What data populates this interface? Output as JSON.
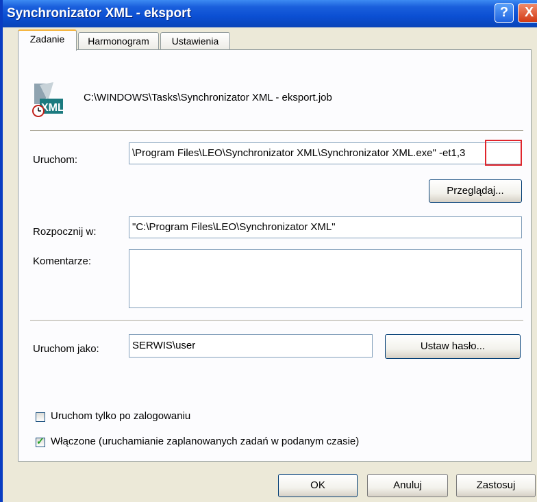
{
  "window": {
    "title": "Synchronizator XML - eksport",
    "help_label": "?",
    "close_label": "X"
  },
  "tabs": [
    {
      "label": "Zadanie",
      "active": true
    },
    {
      "label": "Harmonogram",
      "active": false
    },
    {
      "label": "Ustawienia",
      "active": false
    }
  ],
  "task": {
    "file_path": "C:\\WINDOWS\\Tasks\\Synchronizator XML - eksport.job",
    "icon": "xml-task-icon",
    "run_label": "Uruchom:",
    "run_value": "\\Program Files\\LEO\\Synchronizator XML\\Synchronizator XML.exe\" -et1,3",
    "browse_label": "Przeglądaj...",
    "start_in_label": "Rozpocznij w:",
    "start_in_value": "\"C:\\Program Files\\LEO\\Synchronizator XML\"",
    "comments_label": "Komentarze:",
    "comments_value": "",
    "run_as_label": "Uruchom jako:",
    "run_as_value": "SERWIS\\user",
    "set_password_label": "Ustaw hasło...",
    "logged_on_only_label": "Uruchom tylko po zalogowaniu",
    "logged_on_only_checked": false,
    "enabled_label": "Włączone (uruchamianie zaplanowanych zadań w podanym czasie)",
    "enabled_checked": true
  },
  "footer": {
    "ok_label": "OK",
    "cancel_label": "Anuluj",
    "apply_label": "Zastosuj"
  },
  "colors": {
    "titlebar": "#0b4fd3",
    "highlight": "#e0252c",
    "dialog_bg": "#ECE9D8"
  }
}
